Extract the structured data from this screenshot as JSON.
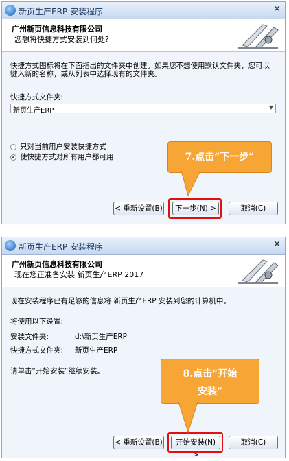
{
  "step1": {
    "window_title": "新页生产ERP 安装程序",
    "header_title": "广州新页信息科技有限公司",
    "header_subtitle": "您想将快捷方式安装到何处?",
    "description": "快捷方式图标将在下面指出的文件夹中创建。如果您不想使用默认文件夹，您可以键入新的名称，或从列表中选择现有的文件夹。",
    "folder_label": "快捷方式文件夹:",
    "folder_value": "新页生产ERP",
    "radio_current_user": "只对当前用户安装快捷方式",
    "radio_all_users": "使快捷方式对所有用户都可用",
    "back_button": "< 重新设置(B)",
    "next_button": "下一步(N) >",
    "cancel_button": "取消(C)",
    "callout": "7.点击“下一步”"
  },
  "step2": {
    "window_title": "新页生产ERP 安装程序",
    "header_title": "广州新页信息科技有限公司",
    "header_subtitle": "现在您正准备安装 新页生产ERP 2017",
    "intro": "现在安装程序已有足够的信息将 新页生产ERP 安装到您的计算机中。",
    "settings_label": "将使用以下设置:",
    "install_folder_label": "安装文件夹:",
    "install_folder_value": "d:\\新页生产ERP",
    "shortcut_folder_label": "快捷方式文件夹:",
    "shortcut_folder_value": "新页生产ERP",
    "continue_text": "请单击“开始安装”继续安装。",
    "back_button": "< 重新设置(B)",
    "start_button": "开始安装(N) >",
    "cancel_button": "取消(C)",
    "callout_line1": "8.点击“开始",
    "callout_line2": "安装”"
  },
  "colors": {
    "callout": "#f7a534",
    "highlight": "#e01010",
    "title_text": "#1e3964"
  },
  "icons": [
    "app-icon",
    "close-icon",
    "installer-logo-icon"
  ]
}
